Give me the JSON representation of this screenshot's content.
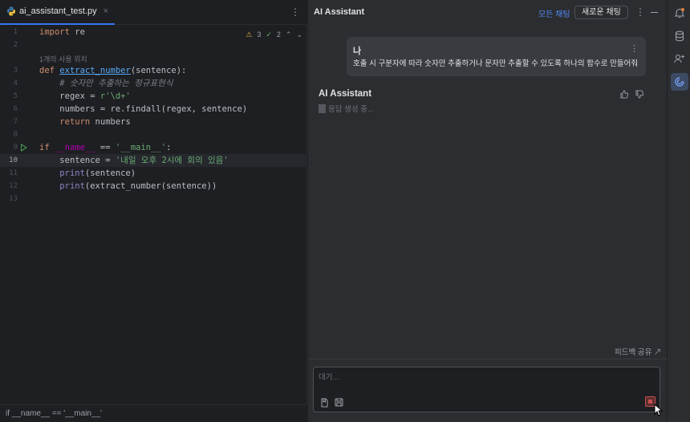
{
  "editor": {
    "tab_label": "ai_assistant_test.py",
    "tab_close": "×",
    "more": "⋮",
    "inspection": {
      "warnings": "3",
      "checks": "2"
    },
    "usage_hint": "1개의 사용 위치",
    "lines": [
      {
        "n": "1"
      },
      {
        "n": "2"
      },
      {
        "n": "3"
      },
      {
        "n": "4"
      },
      {
        "n": "5"
      },
      {
        "n": "6"
      },
      {
        "n": "7"
      },
      {
        "n": "8"
      },
      {
        "n": "9"
      },
      {
        "n": "10"
      },
      {
        "n": "11"
      },
      {
        "n": "12"
      },
      {
        "n": "13"
      }
    ],
    "code": {
      "l1_kw": "import",
      "l1_rest": " re",
      "l3_kw": "def",
      "l3_fn": "extract_number",
      "l3_rest": "(sentence):",
      "l4_cmt": "# 숫자만 추출하는 정규표현식",
      "l5_a": "regex = ",
      "l5_str": "r'\\d+'",
      "l6": "numbers = re.findall(regex, sentence)",
      "l7_kw": "return",
      "l7_rest": " numbers",
      "l9_kw": "if",
      "l9_dunder": "__name__",
      "l9_mid": " == ",
      "l9_str": "'__main__'",
      "l9_end": ":",
      "l10_a": "sentence = ",
      "l10_str": "'내일 오후 2시에 회의 있음'",
      "l11_b": "print",
      "l11_rest": "(sentence)",
      "l12_b": "print",
      "l12_rest": "(extract_number(sentence))"
    },
    "status_text": "if __name__ == '__main__'"
  },
  "assistant": {
    "title": "AI Assistant",
    "all_chats": "모든 채팅",
    "new_chat": "새로운 채팅",
    "more": "⋮",
    "user": {
      "name": "나",
      "message": "호출 시 구분자에 따라 숫자만 추출하거나 문자만 추출할 수 있도록 하나의 함수로 만들어줘",
      "more": "⋮"
    },
    "ai_name": "AI Assistant",
    "generating": "응답 생성 중...",
    "feedback": "피드백 공유 ↗",
    "input_placeholder": "대기..."
  },
  "colors": {
    "accent": "#3574f0",
    "link": "#548af7",
    "stop": "#c94f4f"
  },
  "icons": {
    "right_toolbar": [
      "notifications-icon",
      "database-icon",
      "plugins-icon",
      "ai-assistant-icon"
    ]
  }
}
